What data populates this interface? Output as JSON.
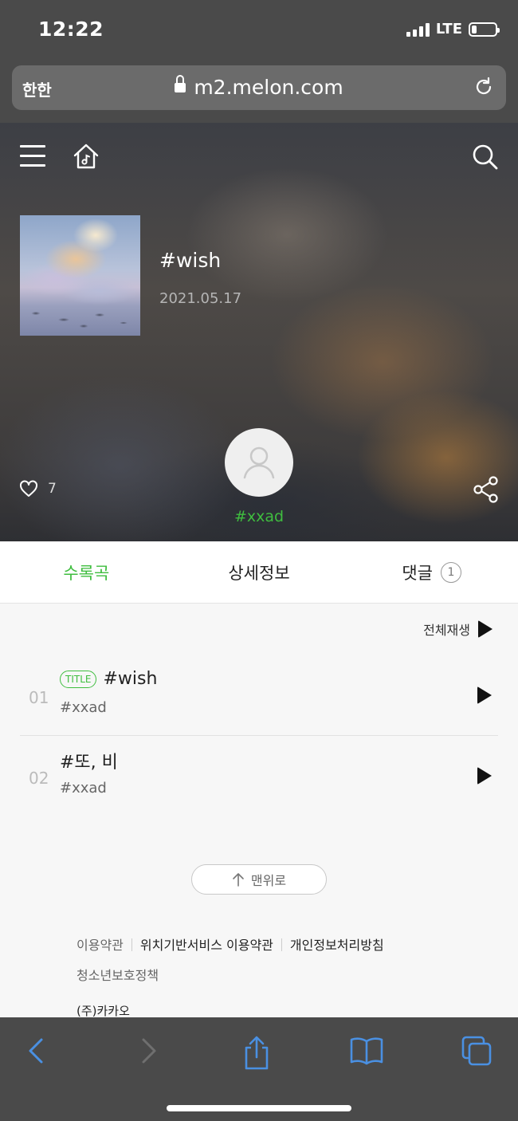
{
  "status_bar": {
    "time": "12:22",
    "network": "LTE",
    "battery_level": 0.2
  },
  "address_bar": {
    "aa_label": "한한",
    "url": "m2.melon.com"
  },
  "album": {
    "title": "#wish",
    "date": "2021.05.17",
    "likes": "7",
    "artist": "#xxad"
  },
  "tabs": [
    {
      "label": "수록곡",
      "active": true
    },
    {
      "label": "상세정보",
      "active": false
    },
    {
      "label": "댓글",
      "count": "1",
      "active": false
    }
  ],
  "play_all_label": "전체재생",
  "tracks": [
    {
      "no": "01",
      "badge": "TITLE",
      "title": "#wish",
      "artist": "#xxad"
    },
    {
      "no": "02",
      "badge": "",
      "title": "#또, 비",
      "artist": "#xxad"
    }
  ],
  "back_to_top_label": "맨위로",
  "footer": {
    "links": [
      "이용약관",
      "위치기반서비스 이용약관",
      "개인정보처리방침",
      "청소년보호정책"
    ],
    "company": "(주)카카오"
  },
  "colors": {
    "accent": "#3fbd3f",
    "chrome": "#4a4a4a",
    "safari_blue": "#4a90e2"
  }
}
